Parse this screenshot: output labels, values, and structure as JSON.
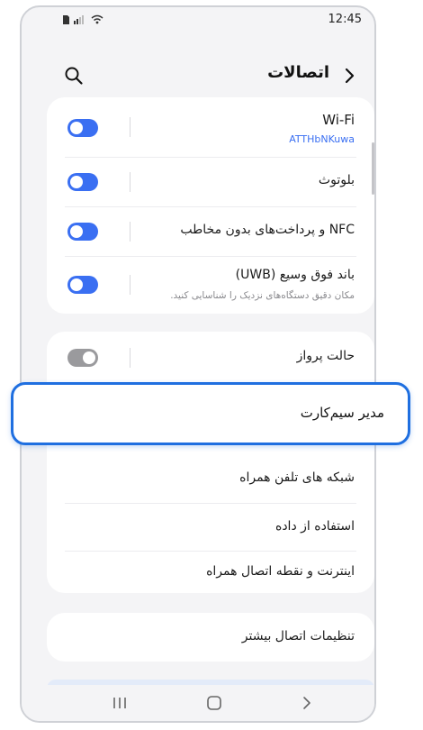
{
  "status": {
    "time": "12:45"
  },
  "header": {
    "title": "اتصالات"
  },
  "section1": {
    "wifi": {
      "label": "Wi-Fi",
      "network": "ATTHbNKuwa",
      "network_color": "#3a6ff2"
    },
    "bluetooth": {
      "label": "بلوتوث"
    },
    "nfc": {
      "label": "NFC و پرداخت‌های بدون مخاطب"
    },
    "uwb": {
      "label": "باند فوق وسیع (UWB)",
      "desc": "مکان دقیق دستگاه‌های نزدیک را شناسایی کنید."
    }
  },
  "section2": {
    "airplane": {
      "label": "حالت پرواز"
    },
    "sim_manager": {
      "label": "مدیر سیم‌کارت"
    },
    "mobile_networks": {
      "label": "شبکه های تلفن همراه"
    },
    "data_usage": {
      "label": "استفاده از داده"
    },
    "hotspot": {
      "label": "اینترنت و نقطه اتصال همراه"
    }
  },
  "section3": {
    "more": {
      "label": "تنظیمات اتصال بیشتر"
    }
  },
  "colors": {
    "accent": "#3a6ff2",
    "highlight_border": "#1f6fe0",
    "toggle_off": "#9a9a9d"
  }
}
